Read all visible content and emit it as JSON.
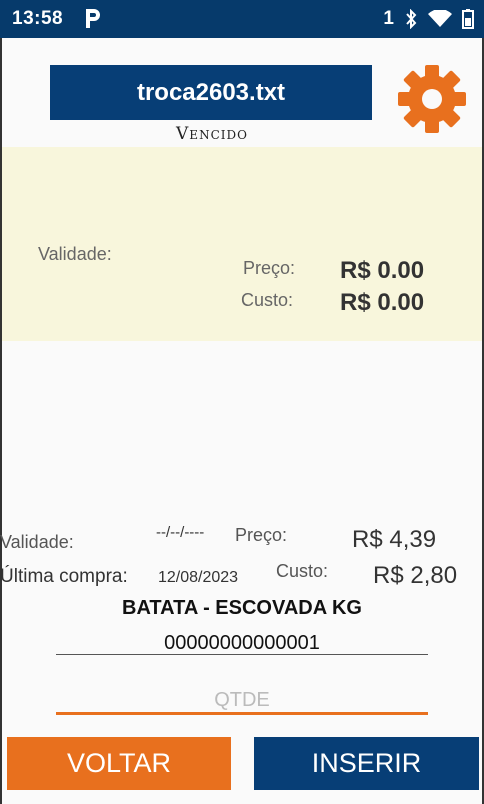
{
  "status_bar": {
    "time": "13:58",
    "notification_icon": "p-icon",
    "sim_indicator": "1",
    "icons": [
      "bluetooth-icon",
      "wifi-icon",
      "battery-icon"
    ],
    "background": "#063a6b"
  },
  "header": {
    "file_name": "troca2603.txt",
    "status": "Vencido",
    "settings_icon": "gear-icon",
    "accent_color": "#e8701e",
    "primary_color": "#073e76"
  },
  "panel": {
    "validade_label": "Validade:",
    "preco_label": "Preço:",
    "preco_value": "R$ 0.00",
    "custo_label": "Custo:",
    "custo_value": "R$ 0.00",
    "background": "#f8f6dc"
  },
  "details": {
    "validade_label": "Validade:",
    "validade_value": "--/--/----",
    "ultima_compra_label": "Última compra:",
    "ultima_compra_value": "12/08/2023",
    "preco_label": "Preço:",
    "preco_value": "R$ 4,39",
    "custo_label": "Custo:",
    "custo_value": "R$ 2,80"
  },
  "product": {
    "name": "BATATA - ESCOVADA KG",
    "code": "00000000000001"
  },
  "quantity": {
    "placeholder": "QTDE",
    "value": ""
  },
  "actions": {
    "back_label": "VOLTAR",
    "insert_label": "INSERIR"
  }
}
